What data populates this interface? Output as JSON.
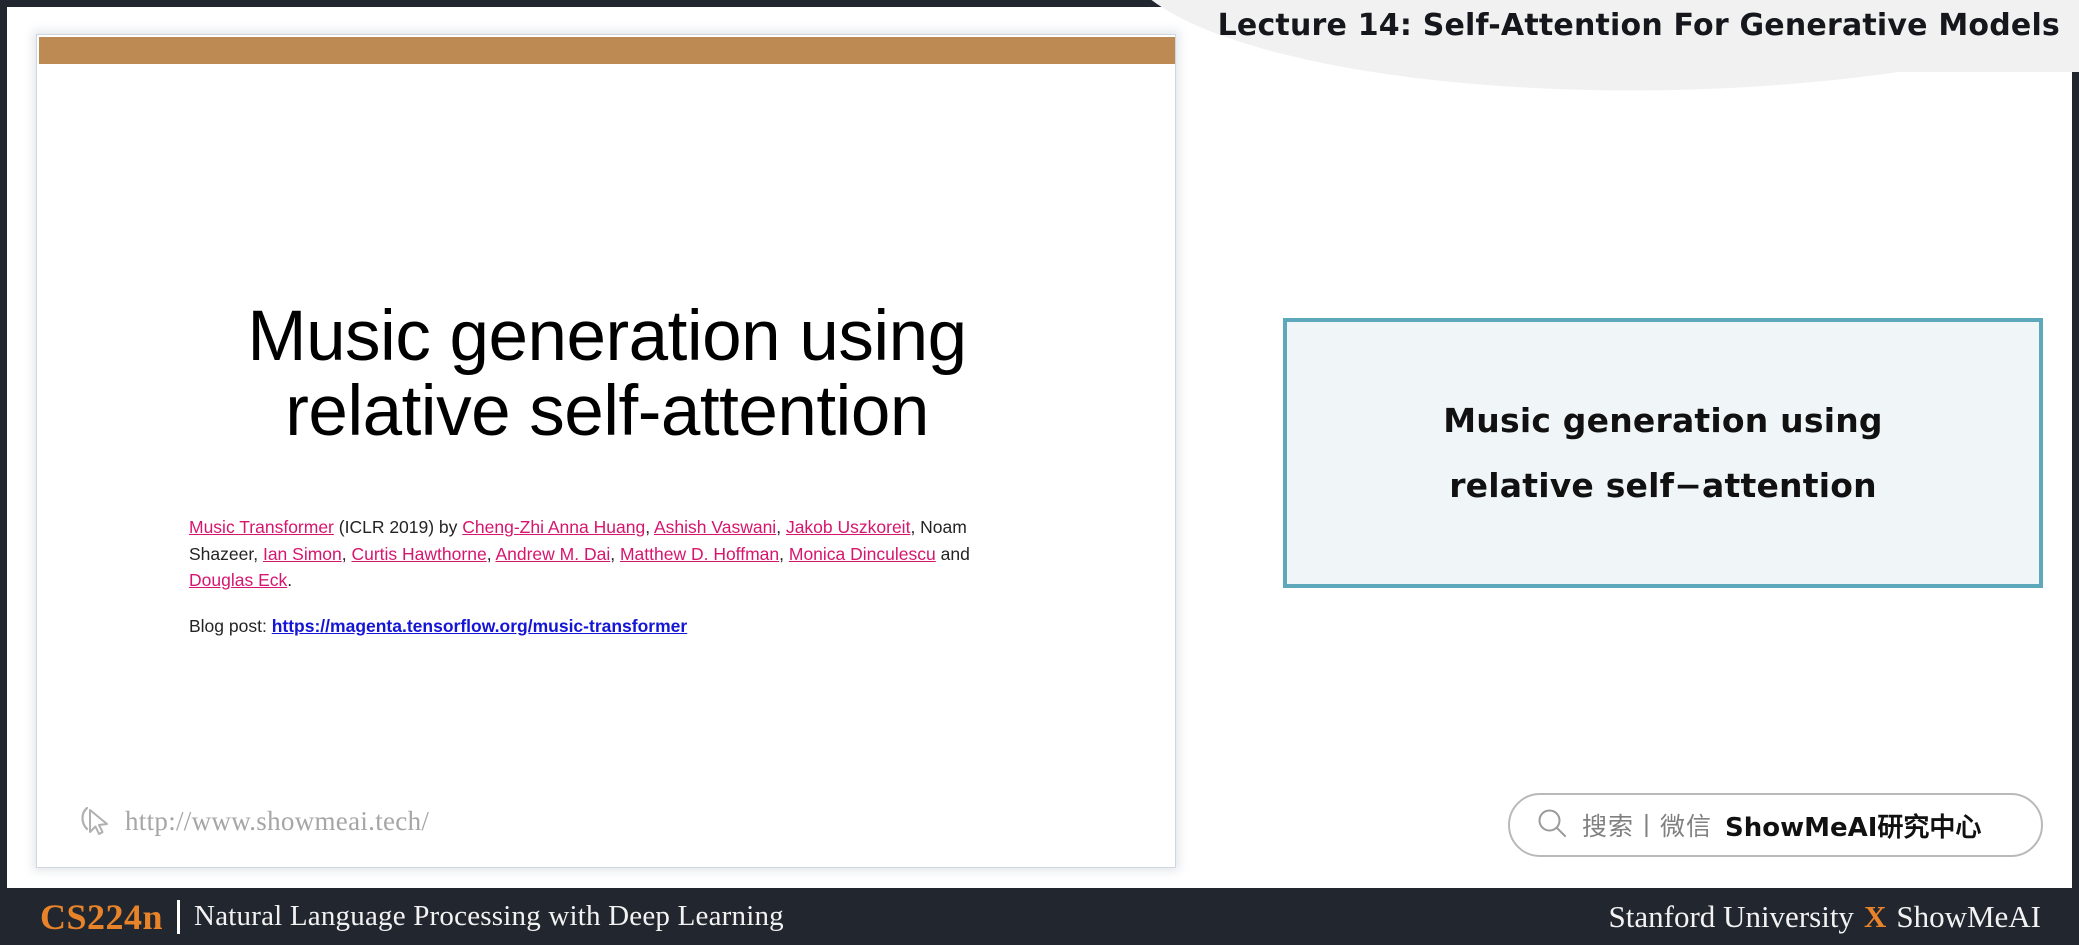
{
  "header": {
    "lecture_title": "Lecture 14:  Self-Attention For Generative Models"
  },
  "slide": {
    "accent_bar_color": "#bd8a54",
    "title_line1": "Music generation using",
    "title_line2": "relative self-attention",
    "citation": {
      "paper_link": "Music Transformer",
      "venue": " (ICLR 2019) by ",
      "authors": [
        {
          "name": "Cheng-Zhi Anna Huang",
          "link": true
        },
        {
          "name": "Ashish Vaswani",
          "link": true
        },
        {
          "name": "Jakob Uszkoreit",
          "link": true
        },
        {
          "name": "Noam Shazeer",
          "link": false
        },
        {
          "name": "Ian Simon",
          "link": true
        },
        {
          "name": "Curtis Hawthorne",
          "link": true
        },
        {
          "name": "Andrew M. Dai",
          "link": true
        },
        {
          "name": "Matthew D. Hoffman",
          "link": true
        },
        {
          "name": "Monica Dinculescu",
          "link": true
        },
        {
          "name": "Douglas Eck",
          "link": true
        }
      ],
      "conjunction": " and ",
      "terminator": ".",
      "link_color": "#d6166e"
    },
    "blog": {
      "label": "Blog post: ",
      "url_text": "https://magenta.tensorflow.org/music-transformer",
      "link_color": "#1515d6"
    },
    "watermark": {
      "icon": "cursor-pointer-icon",
      "text": "http://www.showmeai.tech/"
    }
  },
  "annotation_panel": {
    "border_color": "#5ea8bb",
    "fill_color": "#f0f6f8",
    "line1": "Music generation using",
    "line2": "relative self−attention"
  },
  "search": {
    "icon": "search-icon",
    "label": "搜索丨微信",
    "brand": "ShowMeAI研究中心"
  },
  "footer": {
    "course_code": "CS224n",
    "course_name": "Natural Language Processing with Deep Learning",
    "affiliation_left": "Stanford University",
    "affiliation_x": "X",
    "affiliation_right": "ShowMeAI",
    "accent_color": "#e8832a",
    "background_color": "#22262f"
  }
}
